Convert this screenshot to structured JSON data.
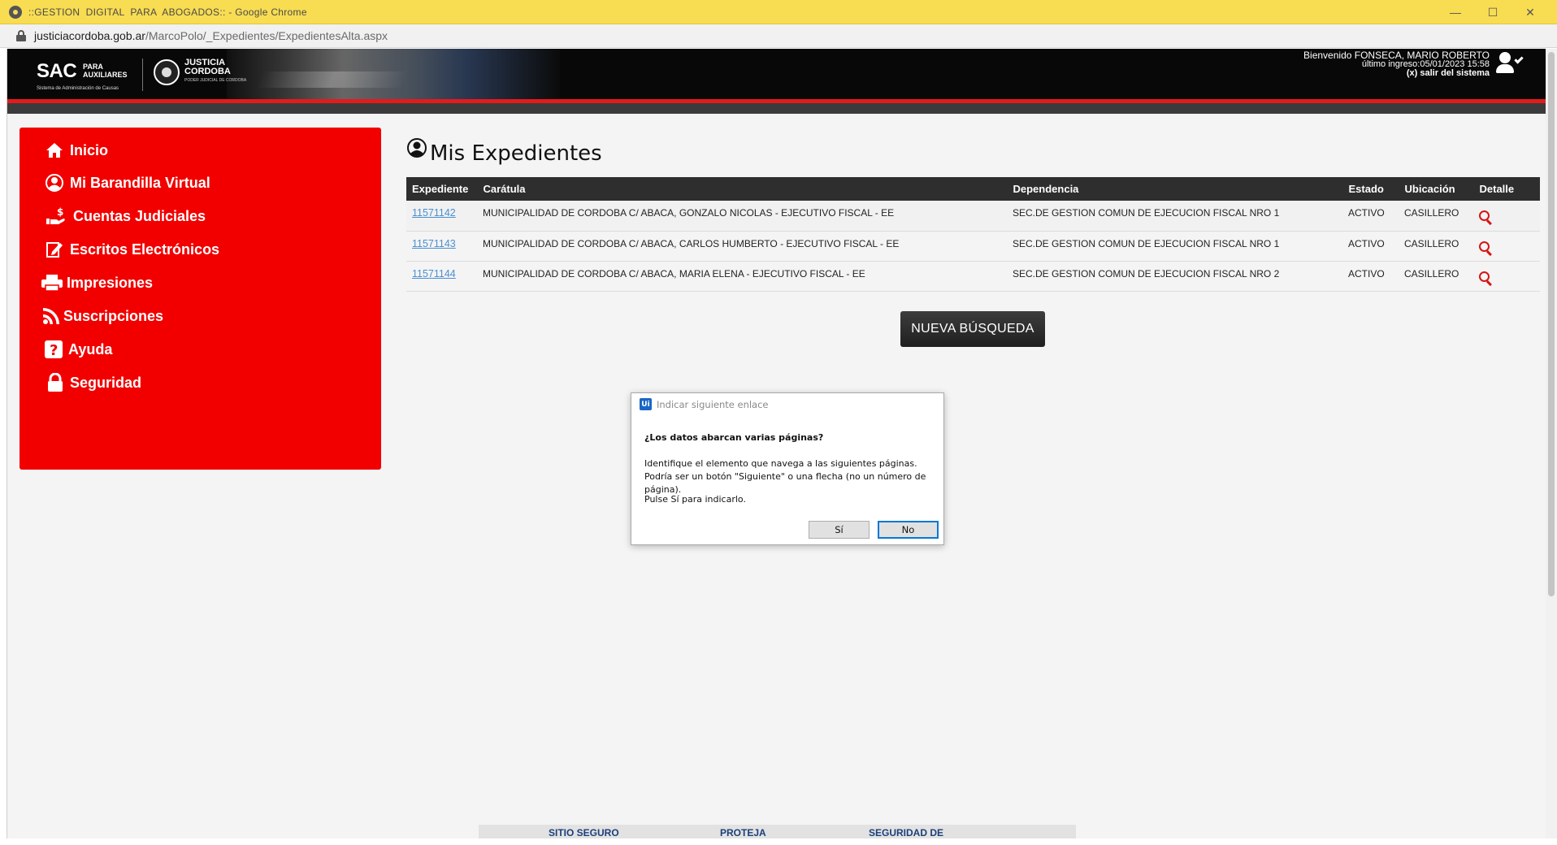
{
  "browser": {
    "window_title": "::GESTION  DIGITAL  PARA  ABOGADOS:: - Google Chrome",
    "url_host": "justiciacordoba.gob.ar",
    "url_path": "/MarcoPolo/_Expedientes/ExpedientesAlta.aspx",
    "controls": {
      "minimize": "—",
      "maximize": "☐",
      "close": "✕"
    }
  },
  "header": {
    "logo_sac": "SAC",
    "logo_para": "PARA",
    "logo_auxiliares": "AUXILIARES",
    "logo_subtitle": "Sistema de Administración de Causas",
    "logo_justicia": "JUSTICIA",
    "logo_cordoba": "CORDOBA",
    "logo_poder": "PODER JUDICIAL DE CORDOBA",
    "welcome": "Bienvenido FONSECA, MARIO ROBERTO",
    "last_login": "último ingreso:05/01/2023 15:58",
    "logout": "(x) salir del sistema"
  },
  "sidebar": {
    "items": [
      {
        "label": "Inicio",
        "icon": "home-icon"
      },
      {
        "label": "Mi Barandilla Virtual",
        "icon": "user-circle-icon"
      },
      {
        "label": "Cuentas Judiciales",
        "icon": "money-hand-icon"
      },
      {
        "label": "Escritos Electrónicos",
        "icon": "edit-document-icon"
      },
      {
        "label": "Impresiones",
        "icon": "printer-icon"
      },
      {
        "label": "Suscripciones",
        "icon": "rss-icon"
      },
      {
        "label": "Ayuda",
        "icon": "question-icon"
      },
      {
        "label": "Seguridad",
        "icon": "lock-icon"
      }
    ]
  },
  "main": {
    "title": "Mis Expedientes",
    "table": {
      "headers": [
        "Expediente",
        "Carátula",
        "Dependencia",
        "Estado",
        "Ubicación",
        "Detalle"
      ],
      "rows": [
        {
          "expediente": "11571142",
          "caratula": "MUNICIPALIDAD DE CORDOBA C/ ABACA, GONZALO NICOLAS - EJECUTIVO FISCAL - EE",
          "dependencia": "SEC.DE GESTION COMUN DE EJECUCION FISCAL NRO 1",
          "estado": "ACTIVO",
          "ubicacion": "CASILLERO"
        },
        {
          "expediente": "11571143",
          "caratula": "MUNICIPALIDAD DE CORDOBA C/ ABACA, CARLOS HUMBERTO - EJECUTIVO FISCAL - EE",
          "dependencia": "SEC.DE GESTION COMUN DE EJECUCION FISCAL NRO 1",
          "estado": "ACTIVO",
          "ubicacion": "CASILLERO"
        },
        {
          "expediente": "11571144",
          "caratula": "MUNICIPALIDAD DE CORDOBA C/ ABACA, MARIA ELENA - EJECUTIVO FISCAL - EE",
          "dependencia": "SEC.DE GESTION COMUN DE EJECUCION FISCAL NRO 2",
          "estado": "ACTIVO",
          "ubicacion": "CASILLERO"
        }
      ]
    },
    "new_search_button": "NUEVA BÚSQUEDA"
  },
  "footer": {
    "links": [
      "SITIO SEGURO",
      "PROTEJA",
      "SEGURIDAD DE"
    ]
  },
  "dialog": {
    "badge": "Ui",
    "title": "Indicar siguiente enlace",
    "question": "¿Los datos abarcan varias páginas?",
    "body": "Identifique el elemento que navega a las siguientes páginas. Podría ser un botón \"Siguiente\" o una flecha (no un número de página).",
    "instruction": "Pulse Sí para indicarlo.",
    "yes_label": "Sí",
    "no_label": "No"
  },
  "colors": {
    "sidebar_red": "#f20000",
    "header_black": "#080808",
    "titlebar_yellow": "#f8dc52",
    "link_blue": "#4a8fd0",
    "detail_icon_red": "#d71414"
  }
}
